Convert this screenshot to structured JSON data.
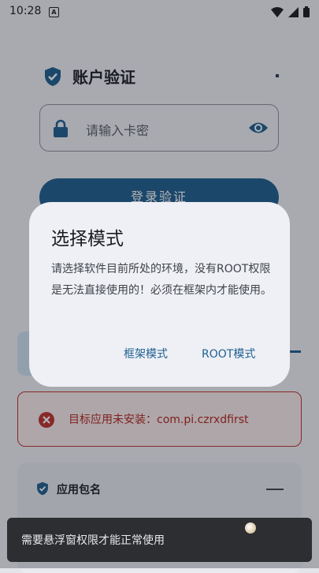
{
  "status_bar": {
    "time": "10:28",
    "notification_glyph": "A",
    "icons": [
      "wifi-icon",
      "signal-icon",
      "battery-icon"
    ]
  },
  "header": {
    "title": "账户验证",
    "icon": "shield-check-icon"
  },
  "card_key_field": {
    "placeholder": "请输入卡密",
    "left_icon": "lock-icon",
    "right_icon": "eye-icon"
  },
  "login_button": {
    "label": "登录验证"
  },
  "error_banner": {
    "text": "目标应用未安装：com.pi.czrxdfirst",
    "icon": "error-x-icon"
  },
  "package_card": {
    "label": "应用包名",
    "icon": "shield-check-icon"
  },
  "dialog": {
    "title": "选择模式",
    "body": "请选择软件目前所处的环境，没有ROOT权限是无法直接使用的！必须在框架内才能使用。",
    "button_frame": "框架模式",
    "button_root": "ROOT模式"
  },
  "toast": {
    "message": "需要悬浮窗权限才能正常使用"
  },
  "colors": {
    "primary": "#1f5f8f",
    "error": "#b3261e",
    "dialog_bg": "#eef0f6",
    "toast_bg": "#2d2e31"
  }
}
